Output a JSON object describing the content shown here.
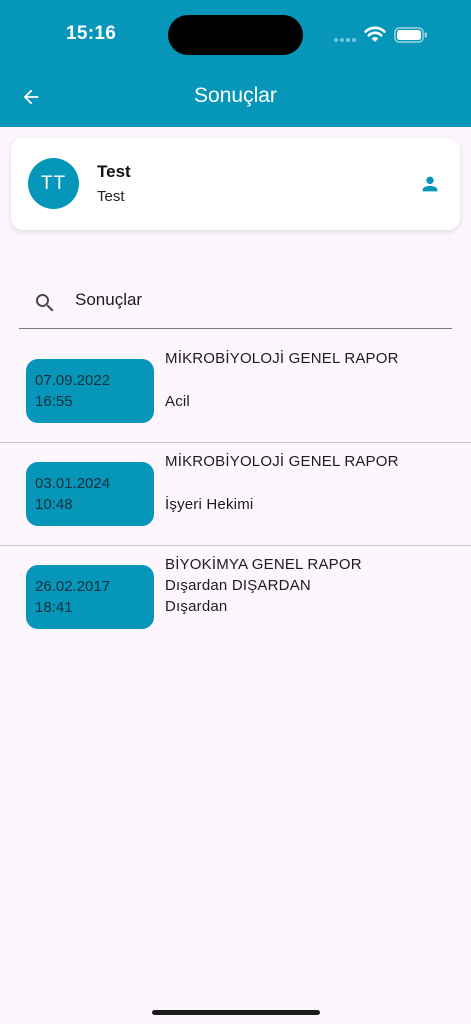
{
  "status_bar": {
    "time": "15:16"
  },
  "header": {
    "title": "Sonuçlar"
  },
  "profile": {
    "initials": "TT",
    "name": "Test",
    "subtitle": "Test"
  },
  "search": {
    "placeholder": "Sonuçlar"
  },
  "results": [
    {
      "date": "07.09.2022",
      "time": "16:55",
      "title": "MİKROBİYOLOJİ GENEL RAPOR",
      "line2": "",
      "line3": "Acil"
    },
    {
      "date": "03.01.2024",
      "time": "10:48",
      "title": "MİKROBİYOLOJİ GENEL RAPOR",
      "line2": "",
      "line3": "İşyeri Hekimi"
    },
    {
      "date": "26.02.2017",
      "time": "18:41",
      "title": "BİYOKİMYA GENEL RAPOR",
      "line2": "Dışardan DIŞARDAN",
      "line3": "Dışardan"
    }
  ],
  "colors": {
    "primary": "#0596ba",
    "background": "#fdf6fd",
    "card": "#ffffff"
  }
}
